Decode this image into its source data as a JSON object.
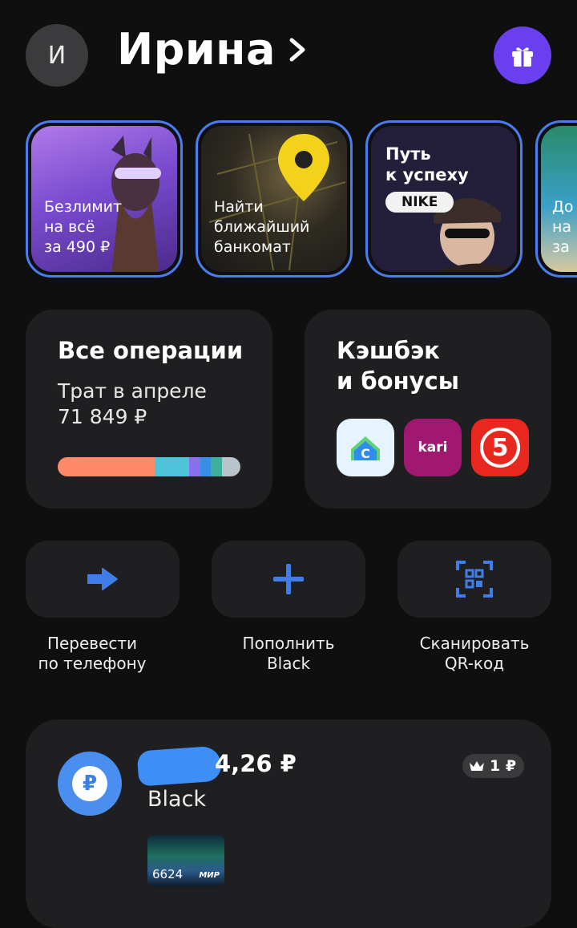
{
  "header": {
    "avatar_initial": "И",
    "user_name": "Ирина",
    "gift_icon": "gift-icon",
    "accent": "#6a3ff0"
  },
  "stories": [
    {
      "text": "Безлимит\nна всё\nза 490 ₽"
    },
    {
      "text": "Найти\nближайший\nбанкомат"
    },
    {
      "title": "Путь\nк успеху",
      "badge": "NIKE"
    },
    {
      "text": "До\nна\nза"
    }
  ],
  "operations": {
    "title": "Все операции",
    "subtitle": "Трат в апреле",
    "amount": "71 849 ₽",
    "segments": [
      {
        "share": 0.53,
        "color": "#ff8a6a"
      },
      {
        "share": 0.19,
        "color": "#4fc3d9"
      },
      {
        "share": 0.06,
        "color": "#8a6ff0"
      },
      {
        "share": 0.06,
        "color": "#3a8ee6"
      },
      {
        "share": 0.06,
        "color": "#3fb0a0"
      },
      {
        "share": 0.1,
        "color": "#b8c4cc"
      }
    ]
  },
  "cashback": {
    "title": "Кэшбэк\nи бонусы",
    "brands": [
      {
        "name": "cian-logo-icon",
        "color": "#e6f4ff"
      },
      {
        "name": "kari-logo-icon",
        "label": "kari",
        "color": "#a01870"
      },
      {
        "name": "pyaterochka-logo-icon",
        "label": "5",
        "color": "#e8271f"
      }
    ]
  },
  "actions": [
    {
      "label": "Перевести\nпо телефону",
      "icon": "arrow-right-icon"
    },
    {
      "label": "Пополнить\nBlack",
      "icon": "plus-icon"
    },
    {
      "label": "Сканировать\nQR-код",
      "icon": "qr-scan-icon"
    }
  ],
  "account": {
    "currency_symbol": "₽",
    "balance_visible": "4,26 ₽",
    "name": "Black",
    "badge": "1 ₽",
    "card_last4": "6624",
    "card_network": "МИР"
  }
}
